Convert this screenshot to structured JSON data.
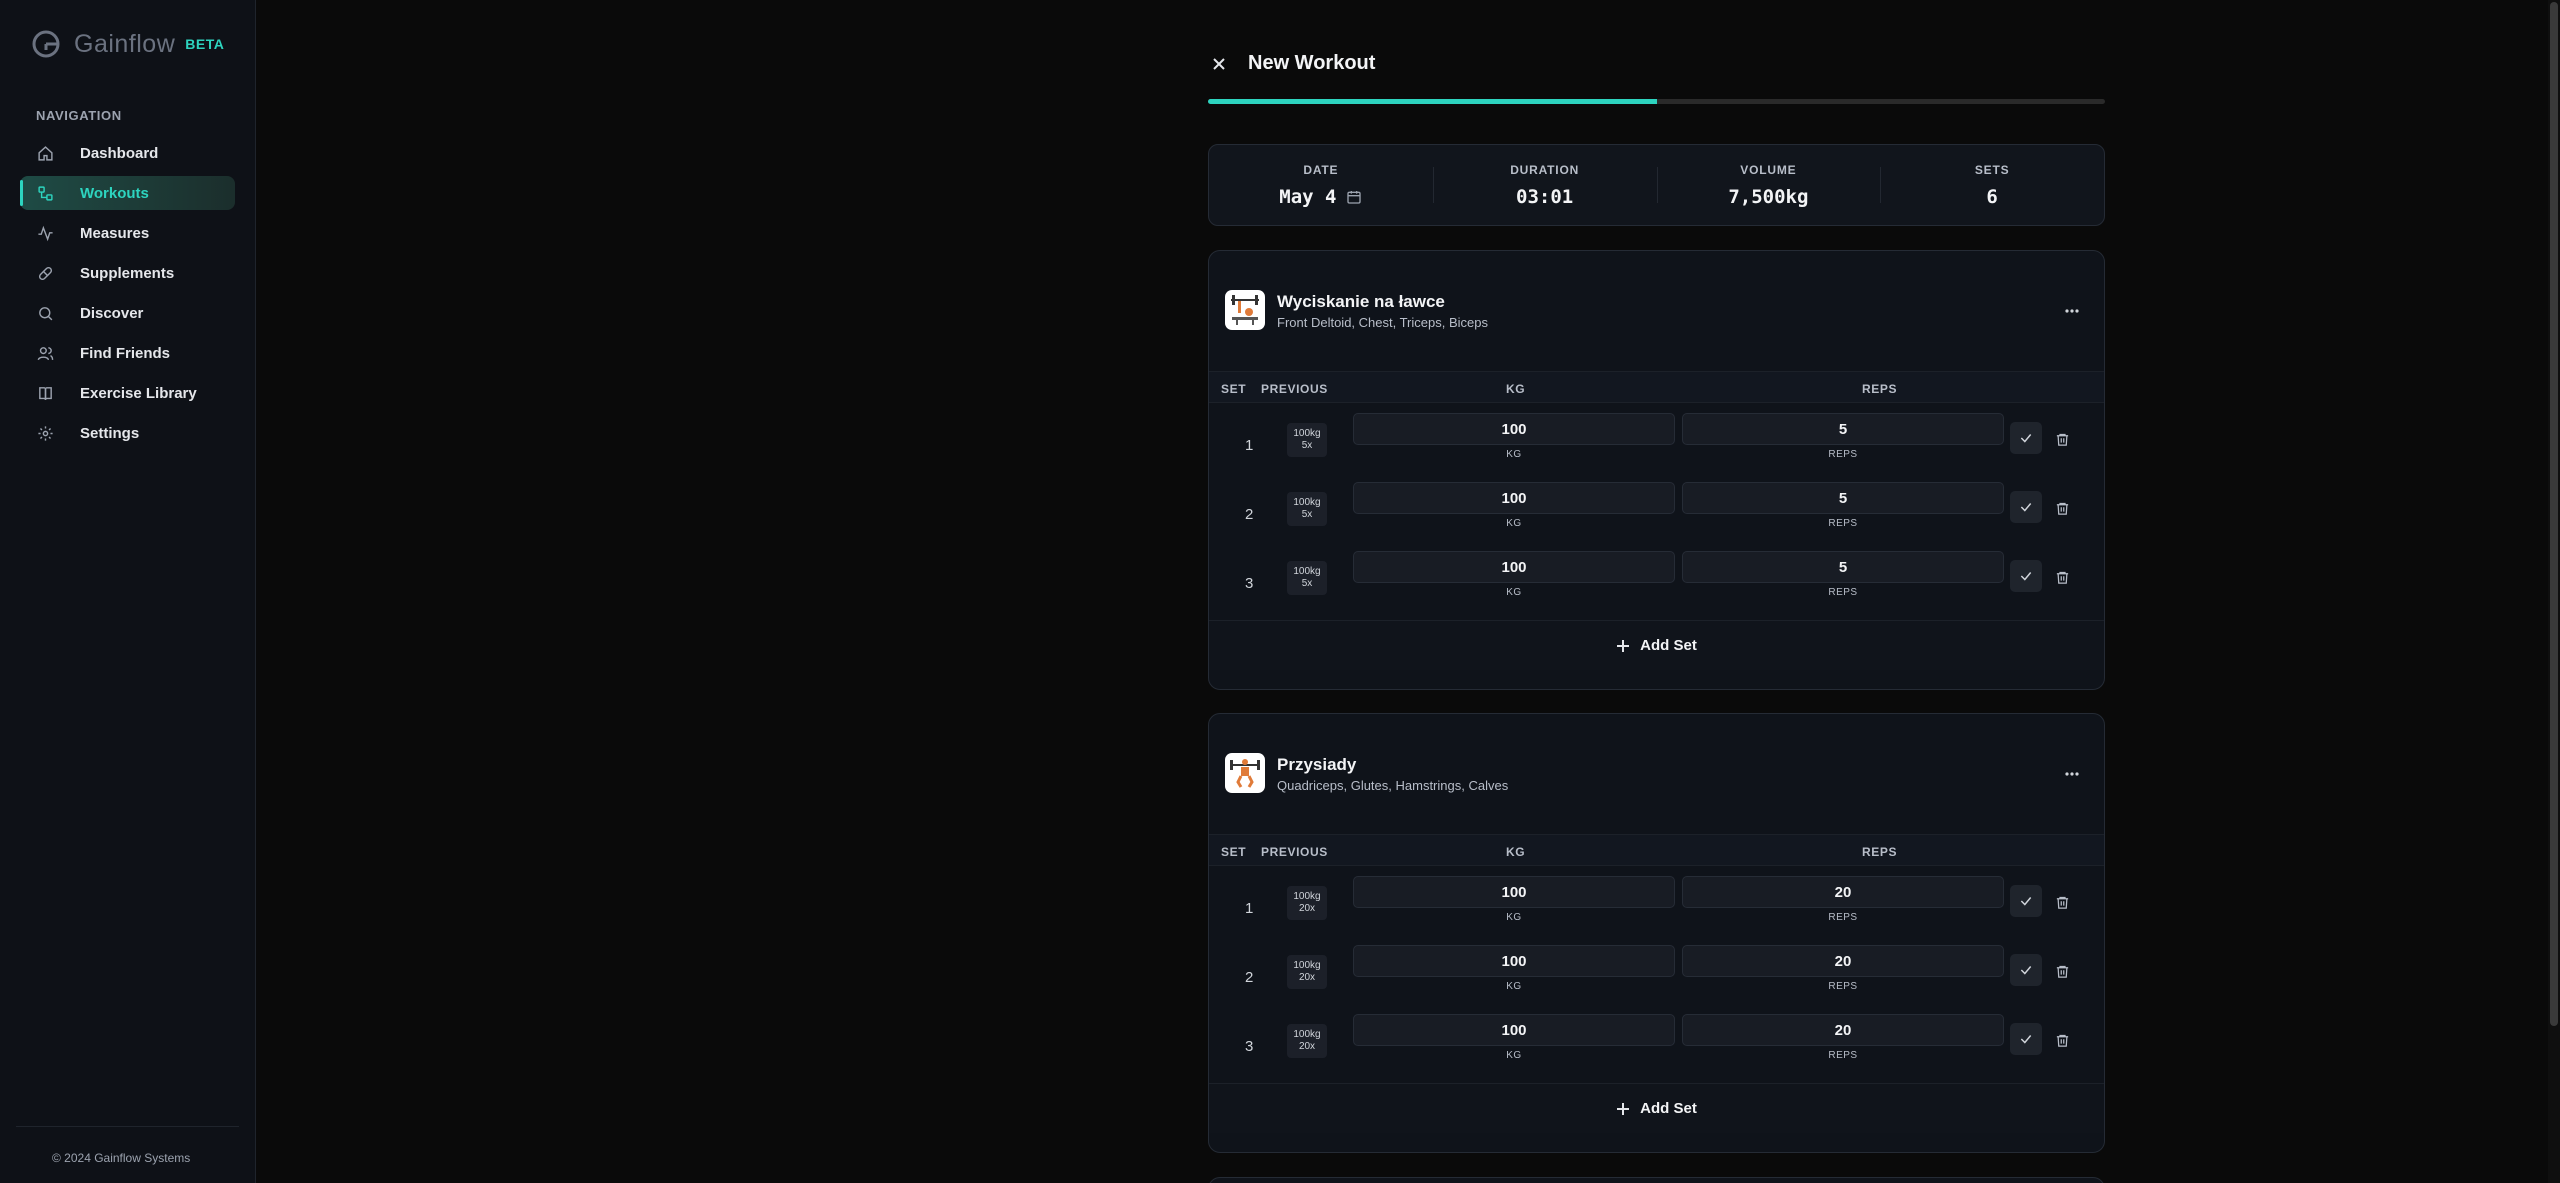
{
  "app": {
    "name": "Gainflow",
    "beta": "BETA",
    "footer": "© 2024 Gainflow Systems"
  },
  "nav": {
    "heading": "NAVIGATION",
    "items": [
      {
        "label": "Dashboard",
        "icon": "home-icon"
      },
      {
        "label": "Workouts",
        "icon": "workouts-icon",
        "active": true
      },
      {
        "label": "Measures",
        "icon": "activity-icon"
      },
      {
        "label": "Supplements",
        "icon": "pill-icon"
      },
      {
        "label": "Discover",
        "icon": "search-icon"
      },
      {
        "label": "Find Friends",
        "icon": "users-icon"
      },
      {
        "label": "Exercise Library",
        "icon": "book-icon"
      },
      {
        "label": "Settings",
        "icon": "gear-icon"
      }
    ]
  },
  "workout": {
    "title": "New Workout",
    "progress": 0.5,
    "stats": {
      "date_label": "DATE",
      "date": "May 4",
      "duration_label": "DURATION",
      "duration": "03:01",
      "volume_label": "VOLUME",
      "volume": "7,500kg",
      "sets_label": "SETS",
      "sets": "6"
    },
    "columns": {
      "set": "SET",
      "previous": "PREVIOUS",
      "kg": "KG",
      "reps": "REPS"
    },
    "unit_kg": "KG",
    "unit_reps": "REPS",
    "add_set": "Add Set",
    "exercises": [
      {
        "name": "Wyciskanie na ławce",
        "muscles": "Front Deltoid, Chest, Triceps, Biceps",
        "sets": [
          {
            "n": "1",
            "prev_kg": "100kg",
            "prev_reps": "5x",
            "kg": "100",
            "reps": "5"
          },
          {
            "n": "2",
            "prev_kg": "100kg",
            "prev_reps": "5x",
            "kg": "100",
            "reps": "5"
          },
          {
            "n": "3",
            "prev_kg": "100kg",
            "prev_reps": "5x",
            "kg": "100",
            "reps": "5"
          }
        ]
      },
      {
        "name": "Przysiady",
        "muscles": "Quadriceps, Glutes, Hamstrings, Calves",
        "sets": [
          {
            "n": "1",
            "prev_kg": "100kg",
            "prev_reps": "20x",
            "kg": "100",
            "reps": "20"
          },
          {
            "n": "2",
            "prev_kg": "100kg",
            "prev_reps": "20x",
            "kg": "100",
            "reps": "20"
          },
          {
            "n": "3",
            "prev_kg": "100kg",
            "prev_reps": "20x",
            "kg": "100",
            "reps": "20"
          }
        ]
      }
    ]
  },
  "colors": {
    "accent": "#2dd4bf",
    "background": "#0a0a0a",
    "card": "#0f131a"
  }
}
